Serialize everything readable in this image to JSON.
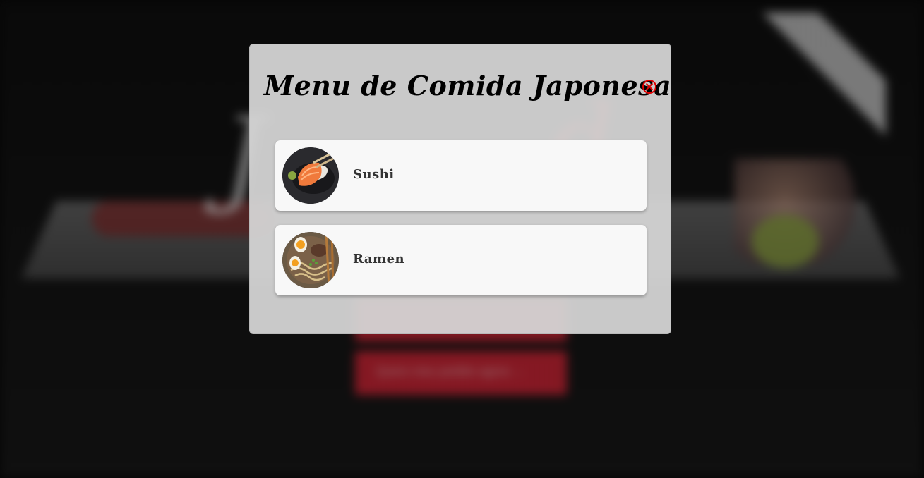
{
  "background": {
    "buttons": [
      {
        "label": ""
      },
      {
        "label": "Quero meu pedido agora →"
      }
    ]
  },
  "modal": {
    "title": "Menu de Comida Japonesa",
    "close_icon": "close-circle-icon",
    "close_color": "#e00000",
    "items": [
      {
        "label": "Sushi",
        "image": "sushi-image"
      },
      {
        "label": "Ramen",
        "image": "ramen-image"
      }
    ]
  }
}
